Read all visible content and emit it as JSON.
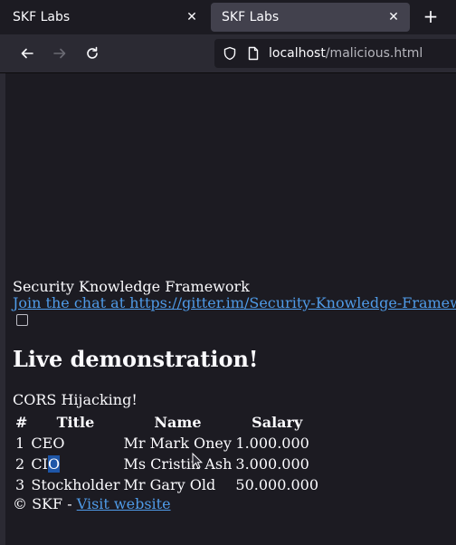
{
  "tabs": [
    {
      "title": "SKF Labs"
    },
    {
      "title": "SKF Labs"
    }
  ],
  "nav": {
    "url_host": "localhost",
    "url_path": "/malicious.html"
  },
  "icons": {
    "close": "close-icon",
    "new_tab": "plus-icon",
    "back": "back-arrow-icon",
    "forward": "forward-arrow-icon",
    "reload": "reload-icon",
    "shield": "shield-icon",
    "page": "page-icon"
  },
  "page": {
    "brand": "Security Knowledge Framework",
    "chat_link": "Join the chat at https://gitter.im/Security-Knowledge-Framework",
    "heading": "Live demonstration!",
    "subtitle": "CORS Hijacking!",
    "table": {
      "headers": [
        "#",
        "Title",
        "Name",
        "Salary"
      ],
      "rows": [
        {
          "num": "1",
          "title_a": "CEO",
          "title_b": "",
          "name": "Mr Mark Oney",
          "salary": "1.000.000"
        },
        {
          "num": "2",
          "title_a": "CI",
          "title_b": "O",
          "name": "Ms Cristin Ash",
          "salary": "3.000.000"
        },
        {
          "num": "3",
          "title_a": "Stockholder",
          "title_b": "",
          "name": "Mr Gary Old",
          "salary": "50.000.000"
        }
      ]
    },
    "footer": {
      "text": "© SKF - ",
      "link": "Visit website"
    }
  },
  "colors": {
    "background": "#1c1b22",
    "toolbar": "#2b2a33",
    "active_tab": "#42414d",
    "link": "#4f9be8",
    "selection": "#1e56a8"
  }
}
